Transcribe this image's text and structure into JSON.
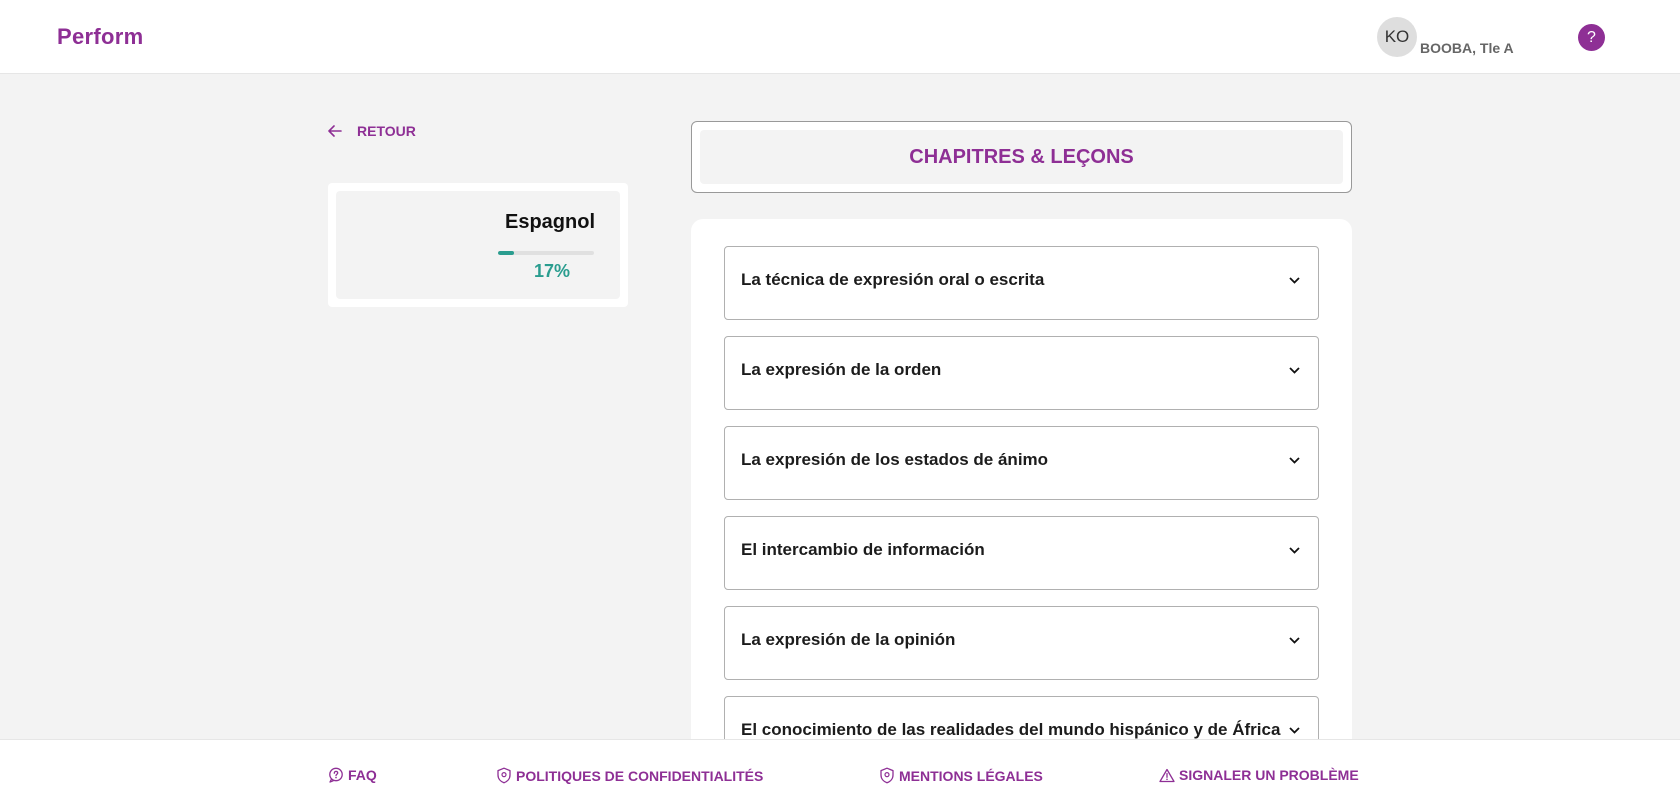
{
  "header": {
    "logo": "Perform",
    "user_initials": "KO",
    "user_name": "BOOBA, Tle A",
    "help": "?"
  },
  "back": {
    "label": "RETOUR"
  },
  "subject": {
    "name": "Espagnol",
    "progress_percent": 17,
    "progress_label": "17%"
  },
  "chapters": {
    "title": "CHAPITRES & LEÇONS",
    "items": [
      {
        "title": "La técnica de expresión oral o escrita"
      },
      {
        "title": "La expresión de la orden"
      },
      {
        "title": "La expresión de los estados de ánimo"
      },
      {
        "title": "El intercambio de información"
      },
      {
        "title": "La expresión de la opinión"
      },
      {
        "title": "El conocimiento de las realidades del mundo hispánico y de África"
      }
    ]
  },
  "footer": {
    "faq": "FAQ",
    "privacy": "POLITIQUES DE CONFIDENTIALITÉS",
    "legal": "MENTIONS LÉGALES",
    "report": "SIGNALER UN PROBLÈME"
  },
  "colors": {
    "brand": "#8e2f95",
    "progress": "#2a9d8f",
    "background": "#f3f3f3"
  }
}
